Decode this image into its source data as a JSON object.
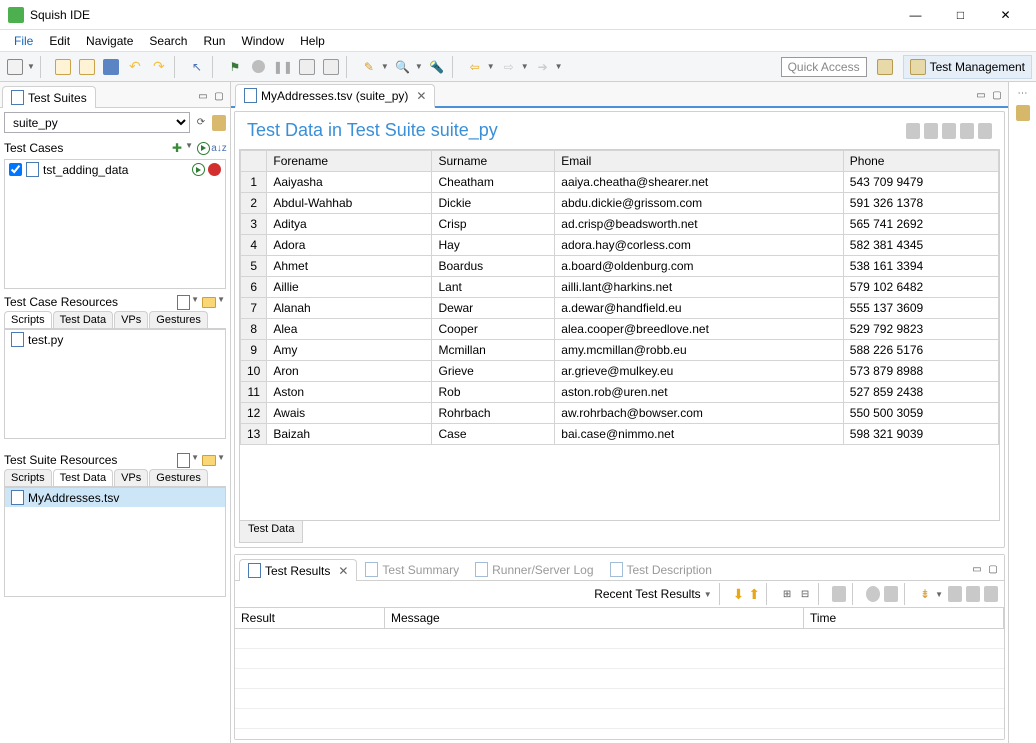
{
  "title": "Squish IDE",
  "menu": [
    "File",
    "Edit",
    "Navigate",
    "Search",
    "Run",
    "Window",
    "Help"
  ],
  "quick_access": "Quick Access",
  "perspective_label": "Test Management",
  "left": {
    "view_title": "Test Suites",
    "suite_combo": "suite_py",
    "test_cases_label": "Test Cases",
    "test_cases": [
      {
        "name": "tst_adding_data",
        "checked": true
      }
    ],
    "tc_res_label": "Test Case Resources",
    "tc_res_tabs": [
      "Scripts",
      "Test Data",
      "VPs",
      "Gestures"
    ],
    "tc_res_files": [
      "test.py"
    ],
    "ts_res_label": "Test Suite Resources",
    "ts_res_tabs": [
      "Scripts",
      "Test Data",
      "VPs",
      "Gestures"
    ],
    "ts_res_files": [
      "MyAddresses.tsv"
    ]
  },
  "editor": {
    "tab_label": "MyAddresses.tsv (suite_py)",
    "title": "Test Data in Test Suite suite_py",
    "columns": [
      "Forename",
      "Surname",
      "Email",
      "Phone"
    ],
    "rows": [
      [
        "Aaiyasha",
        "Cheatham",
        "aaiya.cheatha@shearer.net",
        "543 709 9479"
      ],
      [
        "Abdul-Wahhab",
        "Dickie",
        "abdu.dickie@grissom.com",
        "591 326 1378"
      ],
      [
        "Aditya",
        "Crisp",
        "ad.crisp@beadsworth.net",
        "565 741 2692"
      ],
      [
        "Adora",
        "Hay",
        "adora.hay@corless.com",
        "582 381 4345"
      ],
      [
        "Ahmet",
        "Boardus",
        "a.board@oldenburg.com",
        "538 161 3394"
      ],
      [
        "Aillie",
        "Lant",
        "ailli.lant@harkins.net",
        "579 102 6482"
      ],
      [
        "Alanah",
        "Dewar",
        "a.dewar@handfield.eu",
        "555 137 3609"
      ],
      [
        "Alea",
        "Cooper",
        "alea.cooper@breedlove.net",
        "529 792 9823"
      ],
      [
        "Amy",
        "Mcmillan",
        "amy.mcmillan@robb.eu",
        "588 226 5176"
      ],
      [
        "Aron",
        "Grieve",
        "ar.grieve@mulkey.eu",
        "573 879 8988"
      ],
      [
        "Aston",
        "Rob",
        "aston.rob@uren.net",
        "527 859 2438"
      ],
      [
        "Awais",
        "Rohrbach",
        "aw.rohrbach@bowser.com",
        "550 500 3059"
      ],
      [
        "Baizah",
        "Case",
        "bai.case@nimmo.net",
        "598 321 9039"
      ]
    ],
    "bottom_tab": "Test Data"
  },
  "results": {
    "tabs": [
      "Test Results",
      "Test Summary",
      "Runner/Server Log",
      "Test Description"
    ],
    "recent_label": "Recent Test Results",
    "columns": {
      "result": "Result",
      "message": "Message",
      "time": "Time"
    }
  }
}
